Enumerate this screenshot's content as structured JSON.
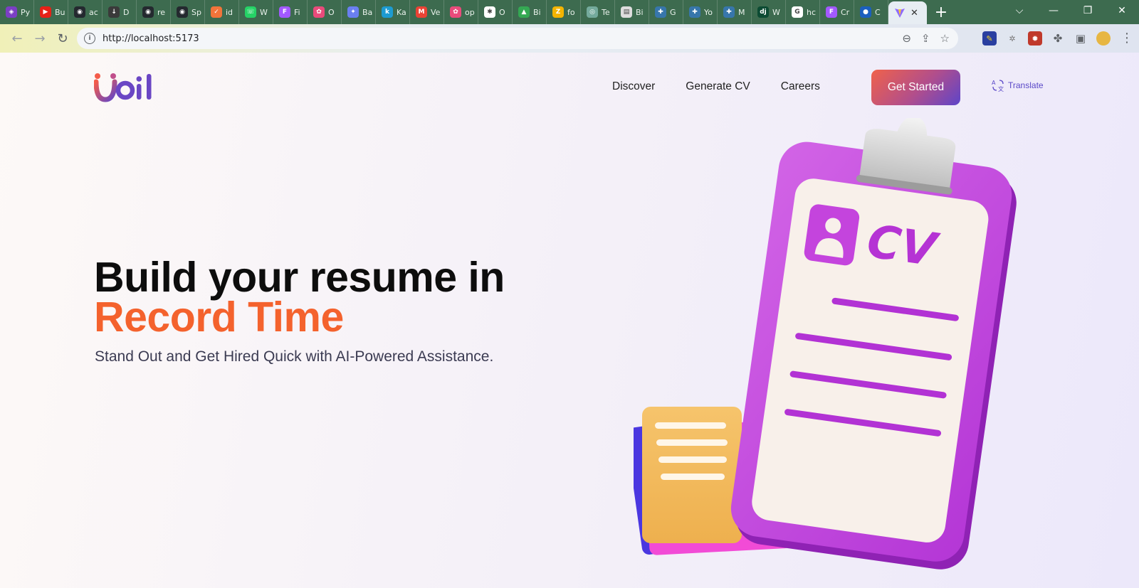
{
  "browser": {
    "tabs": [
      {
        "label": "Py",
        "icon": "hourglass-icon",
        "color": "#7b3fc4",
        "glyph": "◈"
      },
      {
        "label": "Bu",
        "icon": "youtube-icon",
        "color": "#e62117",
        "glyph": "▶"
      },
      {
        "label": "ac",
        "icon": "github-icon",
        "color": "#24292f",
        "glyph": "◉"
      },
      {
        "label": "D",
        "icon": "download-icon",
        "color": "#3a3a3a",
        "glyph": "↓"
      },
      {
        "label": "re",
        "icon": "github-icon",
        "color": "#24292f",
        "glyph": "◉"
      },
      {
        "label": "Sp",
        "icon": "github-icon",
        "color": "#24292f",
        "glyph": "◉"
      },
      {
        "label": "id",
        "icon": "brand-icon",
        "color": "#f2743a",
        "glyph": "✓"
      },
      {
        "label": "W",
        "icon": "whatsapp-icon",
        "color": "#25d366",
        "glyph": "☏"
      },
      {
        "label": "Fi",
        "icon": "figma-icon",
        "color": "#a259ff",
        "glyph": "F"
      },
      {
        "label": "O",
        "icon": "palette-icon",
        "color": "#e94b7b",
        "glyph": "✿"
      },
      {
        "label": "Ba",
        "icon": "sparkle-icon",
        "color": "#6a7ff0",
        "glyph": "✦"
      },
      {
        "label": "Ka",
        "icon": "k-icon",
        "color": "#1d9bd1",
        "glyph": "k"
      },
      {
        "label": "Ve",
        "icon": "gmail-icon",
        "color": "#ea4335",
        "glyph": "M"
      },
      {
        "label": "op",
        "icon": "palette-icon",
        "color": "#e94b7b",
        "glyph": "✿"
      },
      {
        "label": "O",
        "icon": "photos-icon",
        "color": "#ffffff",
        "glyph": "✱"
      },
      {
        "label": "Bi",
        "icon": "drive-icon",
        "color": "#34a853",
        "glyph": "▲"
      },
      {
        "label": "fo",
        "icon": "zap-icon",
        "color": "#f4b400",
        "glyph": "Z"
      },
      {
        "label": "Te",
        "icon": "openai-icon",
        "color": "#74aa9c",
        "glyph": "◎"
      },
      {
        "label": "Bi",
        "icon": "doc-icon",
        "color": "#dddddd",
        "glyph": "▤"
      },
      {
        "label": "G",
        "icon": "python-icon",
        "color": "#3776ab",
        "glyph": "✚"
      },
      {
        "label": "Yo",
        "icon": "python-icon",
        "color": "#3776ab",
        "glyph": "✚"
      },
      {
        "label": "M",
        "icon": "python-icon",
        "color": "#3776ab",
        "glyph": "✚"
      },
      {
        "label": "W",
        "icon": "django-icon",
        "color": "#0c4b33",
        "glyph": "dj"
      },
      {
        "label": "hc",
        "icon": "google-icon",
        "color": "#ffffff",
        "glyph": "G"
      },
      {
        "label": "Cr",
        "icon": "figma-icon",
        "color": "#a259ff",
        "glyph": "F"
      },
      {
        "label": "C",
        "icon": "globe-icon",
        "color": "#1b5fbf",
        "glyph": "●"
      }
    ],
    "active_tab_icon": "vite-icon",
    "url": "http://localhost:5173"
  },
  "site": {
    "nav": {
      "discover": "Discover",
      "generate_cv": "Generate CV",
      "careers": "Careers",
      "cta": "Get Started",
      "translate": "Translate"
    },
    "hero": {
      "line1": "Build your resume in",
      "line2": "Record Time",
      "subtitle": "Stand Out and Get Hired Quick with AI-Powered Assistance."
    },
    "illustration": {
      "badge": "CV"
    },
    "colors": {
      "accent_orange": "#f4622d",
      "brand_purple": "#c846d8",
      "cta_gradient_start": "#f0624a",
      "cta_gradient_end": "#5d45c9"
    }
  }
}
